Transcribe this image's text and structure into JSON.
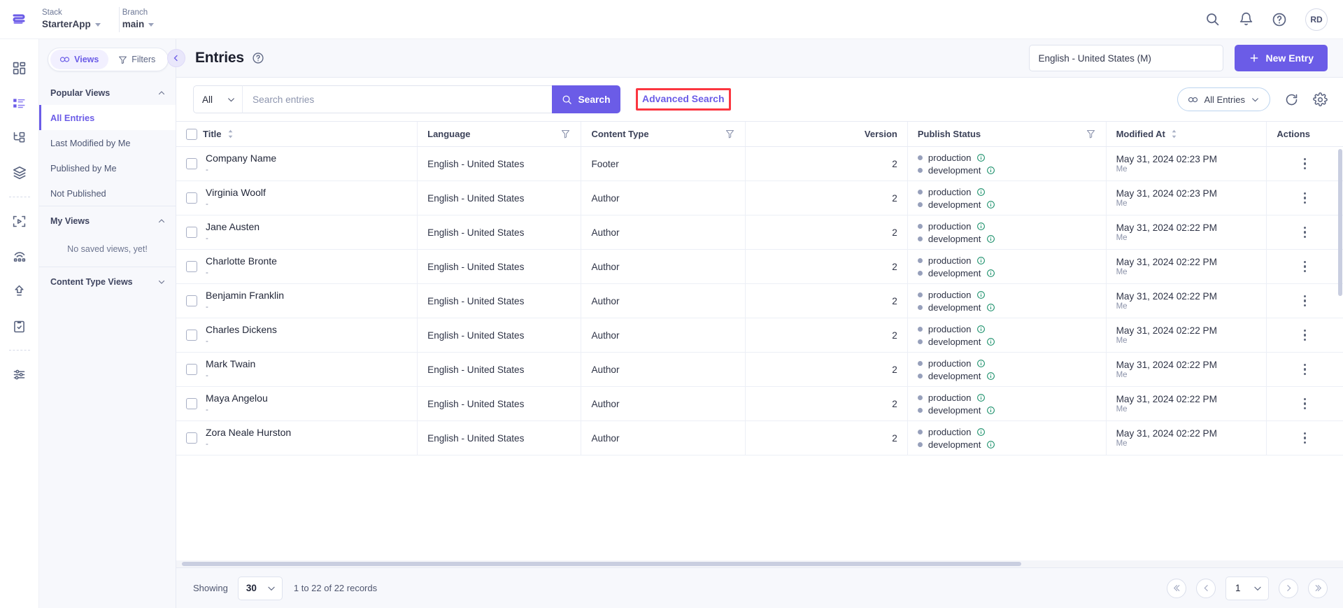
{
  "topbar": {
    "stack_label": "Stack",
    "stack_value": "StarterApp",
    "branch_label": "Branch",
    "branch_value": "main",
    "avatar_initials": "RD"
  },
  "views_panel": {
    "toggle": {
      "views_label": "Views",
      "filters_label": "Filters"
    },
    "sections": [
      {
        "title": "Popular Views",
        "items": [
          "All Entries",
          "Last Modified by Me",
          "Published by Me",
          "Not Published"
        ],
        "active": "All Entries"
      },
      {
        "title": "My Views",
        "empty_text": "No saved views, yet!",
        "items": []
      },
      {
        "title": "Content Type Views",
        "items": []
      }
    ]
  },
  "page": {
    "title": "Entries",
    "language_selected": "English - United States (M)",
    "new_entry_label": "New Entry"
  },
  "toolbar": {
    "scope_value": "All",
    "search_placeholder": "Search entries",
    "search_value": "",
    "search_button_label": "Search",
    "advanced_search_label": "Advanced Search",
    "entries_filter_label": "All Entries",
    "highlight_color": "#fb3640",
    "accent_color": "#6b5ce7"
  },
  "table": {
    "columns": [
      "Title",
      "Language",
      "Content Type",
      "Version",
      "Publish Status",
      "Modified At",
      "Actions"
    ],
    "rows": [
      {
        "title": "Company Name",
        "subtitle": "-",
        "language": "English - United States",
        "content_type": "Footer",
        "version": "2",
        "publish": [
          "production",
          "development"
        ],
        "modified_at": "May 31, 2024 02:23 PM",
        "modified_by": "Me"
      },
      {
        "title": "Virginia Woolf",
        "subtitle": "-",
        "language": "English - United States",
        "content_type": "Author",
        "version": "2",
        "publish": [
          "production",
          "development"
        ],
        "modified_at": "May 31, 2024 02:23 PM",
        "modified_by": "Me"
      },
      {
        "title": "Jane Austen",
        "subtitle": "-",
        "language": "English - United States",
        "content_type": "Author",
        "version": "2",
        "publish": [
          "production",
          "development"
        ],
        "modified_at": "May 31, 2024 02:22 PM",
        "modified_by": "Me"
      },
      {
        "title": "Charlotte Bronte",
        "subtitle": "-",
        "language": "English - United States",
        "content_type": "Author",
        "version": "2",
        "publish": [
          "production",
          "development"
        ],
        "modified_at": "May 31, 2024 02:22 PM",
        "modified_by": "Me"
      },
      {
        "title": "Benjamin Franklin",
        "subtitle": "-",
        "language": "English - United States",
        "content_type": "Author",
        "version": "2",
        "publish": [
          "production",
          "development"
        ],
        "modified_at": "May 31, 2024 02:22 PM",
        "modified_by": "Me"
      },
      {
        "title": "Charles Dickens",
        "subtitle": "-",
        "language": "English - United States",
        "content_type": "Author",
        "version": "2",
        "publish": [
          "production",
          "development"
        ],
        "modified_at": "May 31, 2024 02:22 PM",
        "modified_by": "Me"
      },
      {
        "title": "Mark Twain",
        "subtitle": "-",
        "language": "English - United States",
        "content_type": "Author",
        "version": "2",
        "publish": [
          "production",
          "development"
        ],
        "modified_at": "May 31, 2024 02:22 PM",
        "modified_by": "Me"
      },
      {
        "title": "Maya Angelou",
        "subtitle": "-",
        "language": "English - United States",
        "content_type": "Author",
        "version": "2",
        "publish": [
          "production",
          "development"
        ],
        "modified_at": "May 31, 2024 02:22 PM",
        "modified_by": "Me"
      },
      {
        "title": "Zora Neale Hurston",
        "subtitle": "-",
        "language": "English - United States",
        "content_type": "Author",
        "version": "2",
        "publish": [
          "production",
          "development"
        ],
        "modified_at": "May 31, 2024 02:22 PM",
        "modified_by": "Me"
      }
    ]
  },
  "footer": {
    "showing_label": "Showing",
    "page_size": "30",
    "records_text": "1 to 22 of 22 records",
    "current_page": "1"
  }
}
